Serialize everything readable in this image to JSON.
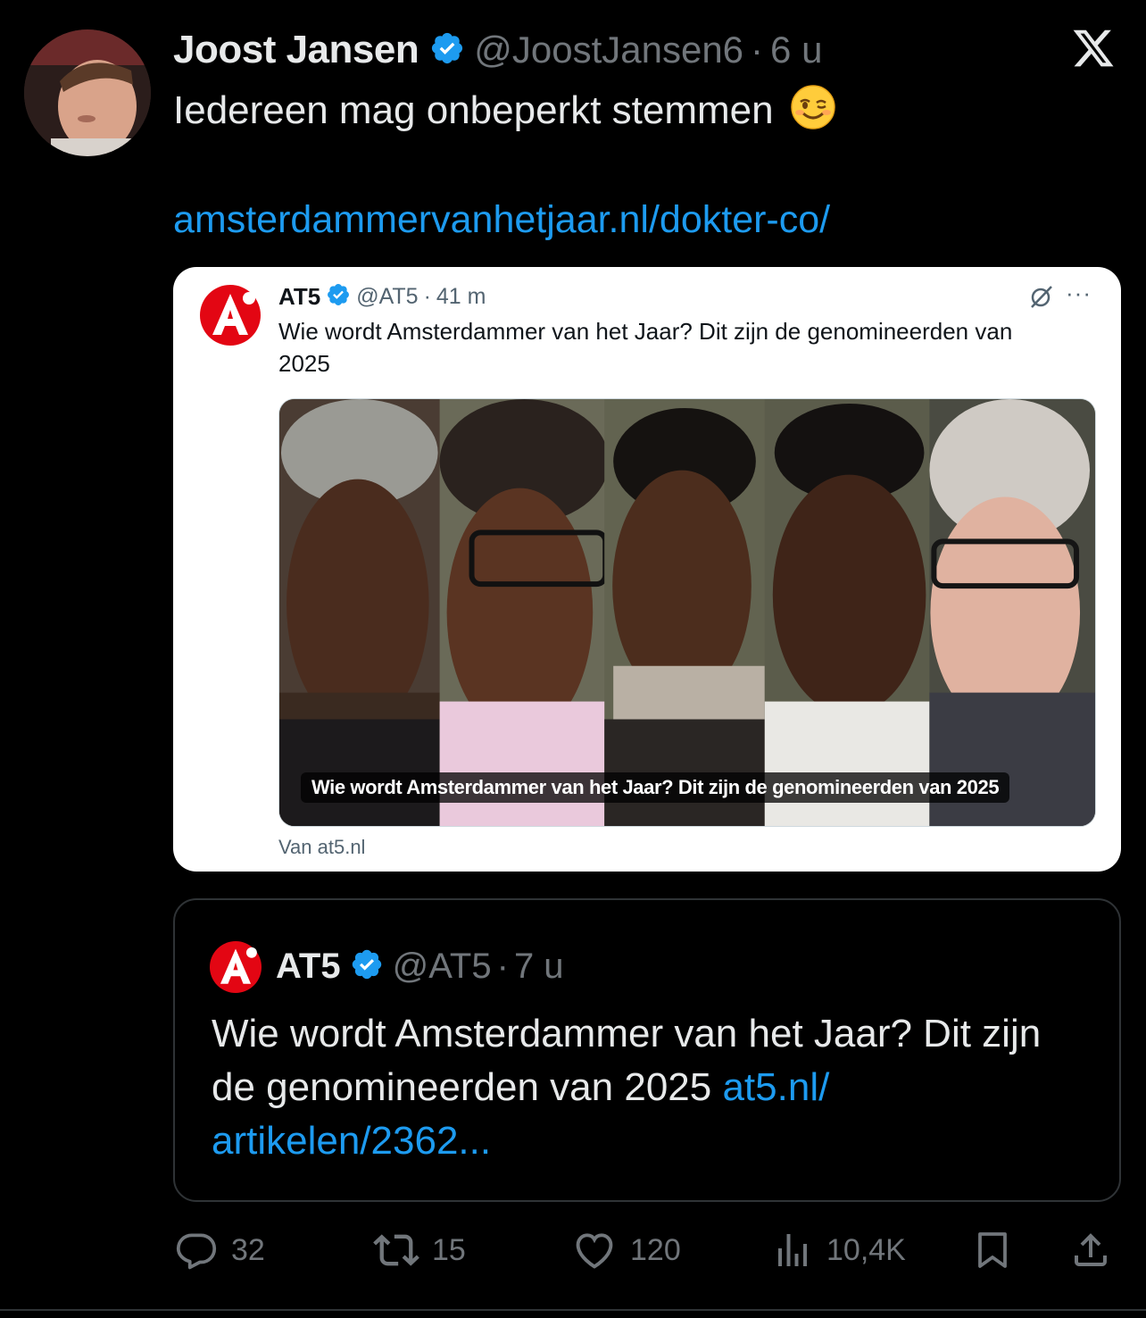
{
  "tweet": {
    "author_name": "Joost Jansen",
    "handle": "@JoostJansen6",
    "separator": "·",
    "time": "6 u",
    "text": "Iedereen mag onbeperkt stemmen",
    "emoji": "winking-face",
    "link": "amsterdammervanhetjaar.nl/dokter-co/"
  },
  "embed": {
    "author_name": "AT5",
    "handle": "@AT5",
    "separator": "·",
    "time": "41 m",
    "more": "···",
    "text": "Wie wordt Amsterdammer van het Jaar? Dit zijn de genomineerden van 2025",
    "media_caption": "Wie wordt Amsterdammer van het Jaar? Dit zijn de genomineerden van 2025",
    "source": "Van at5.nl"
  },
  "quote": {
    "author_name": "AT5",
    "handle": "@AT5",
    "separator": "·",
    "time": "7 u",
    "text": "Wie wordt Amsterdammer van het Jaar? Dit zijn de genomineerden van 2025 ",
    "link": "at5.nl/ artikelen/2362..."
  },
  "actions": {
    "replies": "32",
    "reposts": "15",
    "likes": "120",
    "views": "10,4K"
  },
  "colors": {
    "background": "#000000",
    "text": "#e7e9ea",
    "muted": "#71767b",
    "link": "#1d9bf0",
    "verified": "#1d9bf0",
    "at5_red": "#e30613"
  }
}
